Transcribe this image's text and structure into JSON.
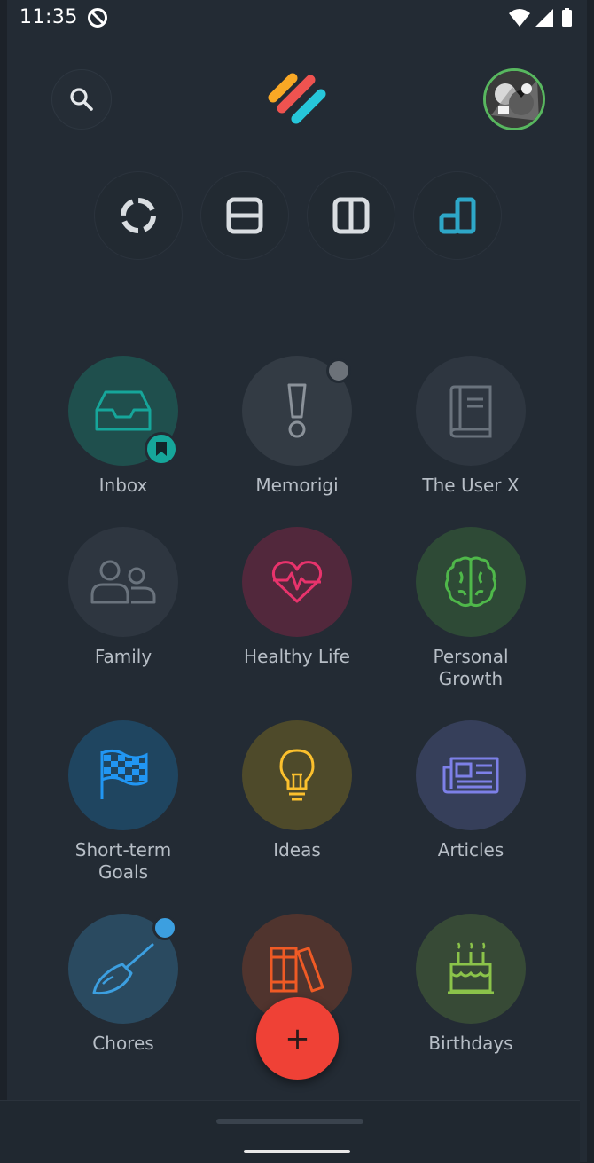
{
  "status_bar": {
    "time": "11:35",
    "icons": [
      "do-not-disturb-icon",
      "wifi-icon",
      "signal-icon",
      "battery-icon"
    ]
  },
  "header": {
    "search_icon": "search-icon",
    "logo": "app-logo",
    "avatar": "user-avatar"
  },
  "view_modes": [
    {
      "name": "circle-view",
      "icon": "ring-icon",
      "active": false
    },
    {
      "name": "rows-view",
      "icon": "rows-icon",
      "active": false
    },
    {
      "name": "columns-view",
      "icon": "columns-icon",
      "active": false
    },
    {
      "name": "grid-view",
      "icon": "stacked-squares-icon",
      "active": true,
      "color": "#2ea7c8"
    }
  ],
  "categories": [
    {
      "label": "Inbox",
      "icon": "inbox-tray-icon",
      "bg": "#1f4f4d",
      "color": "#16a69a",
      "badge": "bookmark"
    },
    {
      "label": "Memorigi",
      "icon": "exclamation-icon",
      "bg": "#333b44",
      "color": "#8b929a",
      "badge": "grey-dot"
    },
    {
      "label": "The User X",
      "icon": "book-icon",
      "bg": "#2e3640",
      "color": "#6a737d"
    },
    {
      "label": "Family",
      "icon": "people-icon",
      "bg": "#2e3640",
      "color": "#6a737d"
    },
    {
      "label": "Healthy Life",
      "icon": "heartbeat-icon",
      "bg": "#52283c",
      "color": "#e8336c"
    },
    {
      "label": "Personal\nGrowth",
      "icon": "brain-icon",
      "bg": "#2e4a36",
      "color": "#4fb84a"
    },
    {
      "label": "Short-term\nGoals",
      "icon": "checkered-flag-icon",
      "bg": "#1f4560",
      "color": "#2196f3"
    },
    {
      "label": "Ideas",
      "icon": "lightbulb-icon",
      "bg": "#4e4a2a",
      "color": "#fbc02d"
    },
    {
      "label": "Articles",
      "icon": "newspaper-icon",
      "bg": "#363f5a",
      "color": "#7d80e8"
    },
    {
      "label": "Chores",
      "icon": "broom-icon",
      "bg": "#2a4a60",
      "color": "#3c9fe0",
      "badge": "blue-dot"
    },
    {
      "label": "",
      "icon": "books-icon",
      "bg": "#50342e",
      "color": "#ef5a25"
    },
    {
      "label": "Birthdays",
      "icon": "cake-icon",
      "bg": "#374a36",
      "color": "#8bc34a"
    }
  ],
  "fab": {
    "label": "+",
    "icon": "plus-icon",
    "color": "#ef4136"
  }
}
